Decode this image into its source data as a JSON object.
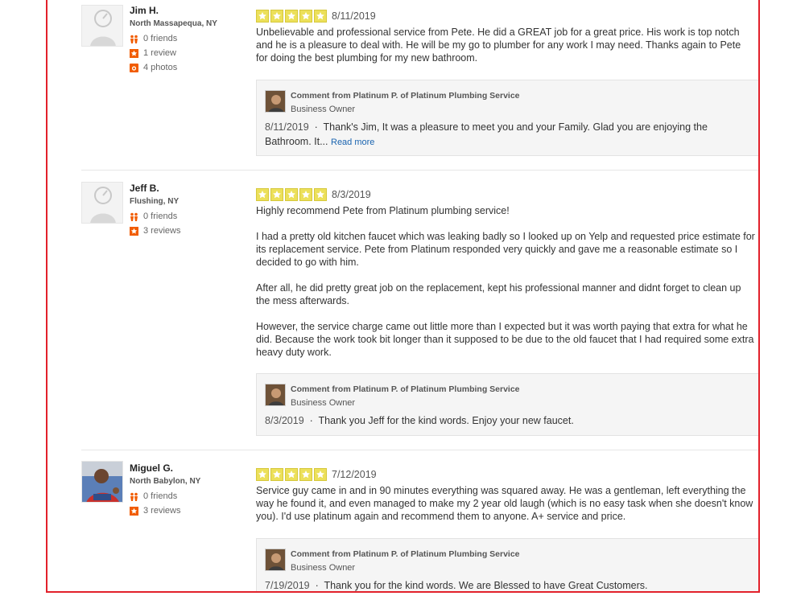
{
  "colors": {
    "frame_border": "#e2212b",
    "star_fill": "#ece05a",
    "link": "#1a64b0"
  },
  "reviews": [
    {
      "user": {
        "name": "Jim H.",
        "location": "North Massapequa, NY",
        "friends": "0 friends",
        "reviews": "1 review",
        "photos": "4 photos",
        "avatar": "default-avatar-icon"
      },
      "rating": 5,
      "date": "8/11/2019",
      "text": "Unbelievable and professional service from Pete. He did a GREAT job for a great price. His work is top notch and he is a pleasure to deal with. He will be my go to plumber for any work I may need. Thanks again to Pete for doing the best plumbing for my new bathroom.",
      "owner_comment": {
        "title": "Comment from Platinum P. of Platinum Plumbing Service",
        "role": "Business Owner",
        "date": "8/11/2019",
        "separator": "·",
        "text": "Thank's Jim, It was a pleasure to meet you and your Family. Glad you are enjoying the Bathroom. It...",
        "read_more": "Read more"
      }
    },
    {
      "user": {
        "name": "Jeff B.",
        "location": "Flushing, NY",
        "friends": "0 friends",
        "reviews": "3 reviews",
        "avatar": "default-avatar-icon"
      },
      "rating": 5,
      "date": "8/3/2019",
      "text": "Highly recommend Pete from Platinum plumbing service!\n\nI had a pretty old kitchen faucet which was leaking badly so I looked up on Yelp and requested price estimate for its replacement service.  Pete from Platinum responded very quickly and gave me a reasonable estimate so I decided to go with him.\n\nAfter all, he did pretty great job on the replacement, kept his professional manner and didnt forget to clean up the mess afterwards.\n\nHowever,  the service charge came out little more than I expected but it was worth paying that extra for what he did.  Because the work took bit longer than it supposed to be due to the old faucet that I had required some extra heavy duty work.",
      "owner_comment": {
        "title": "Comment from Platinum P. of Platinum Plumbing Service",
        "role": "Business Owner",
        "date": "8/3/2019",
        "separator": "·",
        "text": "Thank you Jeff for the kind words. Enjoy your new faucet."
      }
    },
    {
      "user": {
        "name": "Miguel G.",
        "location": "North Babylon, NY",
        "friends": "0 friends",
        "reviews": "3 reviews",
        "avatar": "user-photo"
      },
      "rating": 5,
      "date": "7/12/2019",
      "text": "Service guy came in and in 90 minutes everything was squared away. He was a gentleman, left everything the way he found it, and even managed to make my 2 year old laugh (which is no easy task when she doesn't know you). I'd use platinum again and recommend them to anyone. A+ service and price.",
      "owner_comment": {
        "title": "Comment from Platinum P. of Platinum Plumbing Service",
        "role": "Business Owner",
        "date": "7/19/2019",
        "separator": "·",
        "text": "Thank you for the kind words. We are Blessed to have Great Customers."
      }
    }
  ]
}
